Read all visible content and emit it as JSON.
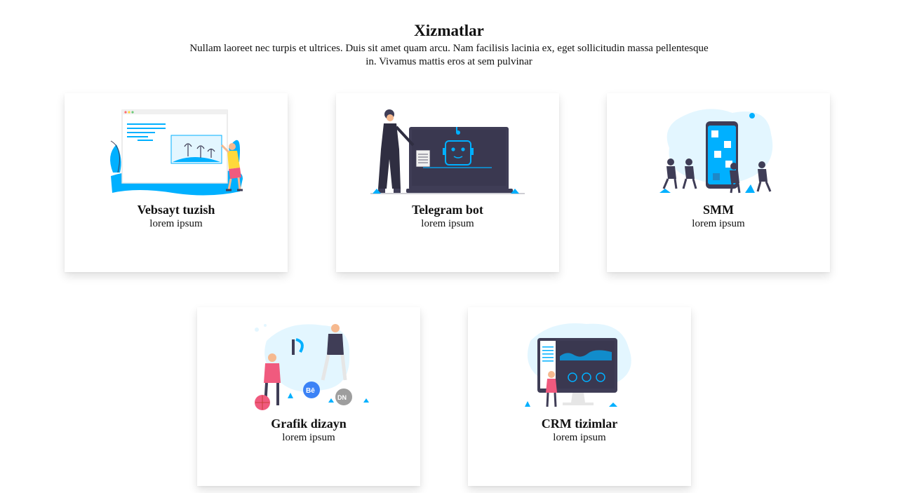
{
  "section": {
    "title": "Xizmatlar",
    "description": "Nullam laoreet nec turpis et ultrices. Duis sit amet quam arcu. Nam facilisis lacinia ex, eget sollicitudin massa pellentesque in. Vivamus mattis eros at sem pulvinar"
  },
  "colors": {
    "accent": "#00b0ff",
    "dark": "#3f3d56",
    "pink": "#f05a7e",
    "light_blue": "#e3f6ff"
  },
  "services": [
    {
      "title": "Vebsayt tuzish",
      "text": "lorem ipsum",
      "icon": "website-illustration"
    },
    {
      "title": "Telegram bot",
      "text": "lorem ipsum",
      "icon": "bot-illustration"
    },
    {
      "title": "SMM",
      "text": "lorem ipsum",
      "icon": "smm-illustration"
    },
    {
      "title": "Grafik dizayn",
      "text": "lorem ipsum",
      "icon": "design-illustration"
    },
    {
      "title": "CRM tizimlar",
      "text": "lorem ipsum",
      "icon": "crm-illustration"
    }
  ]
}
